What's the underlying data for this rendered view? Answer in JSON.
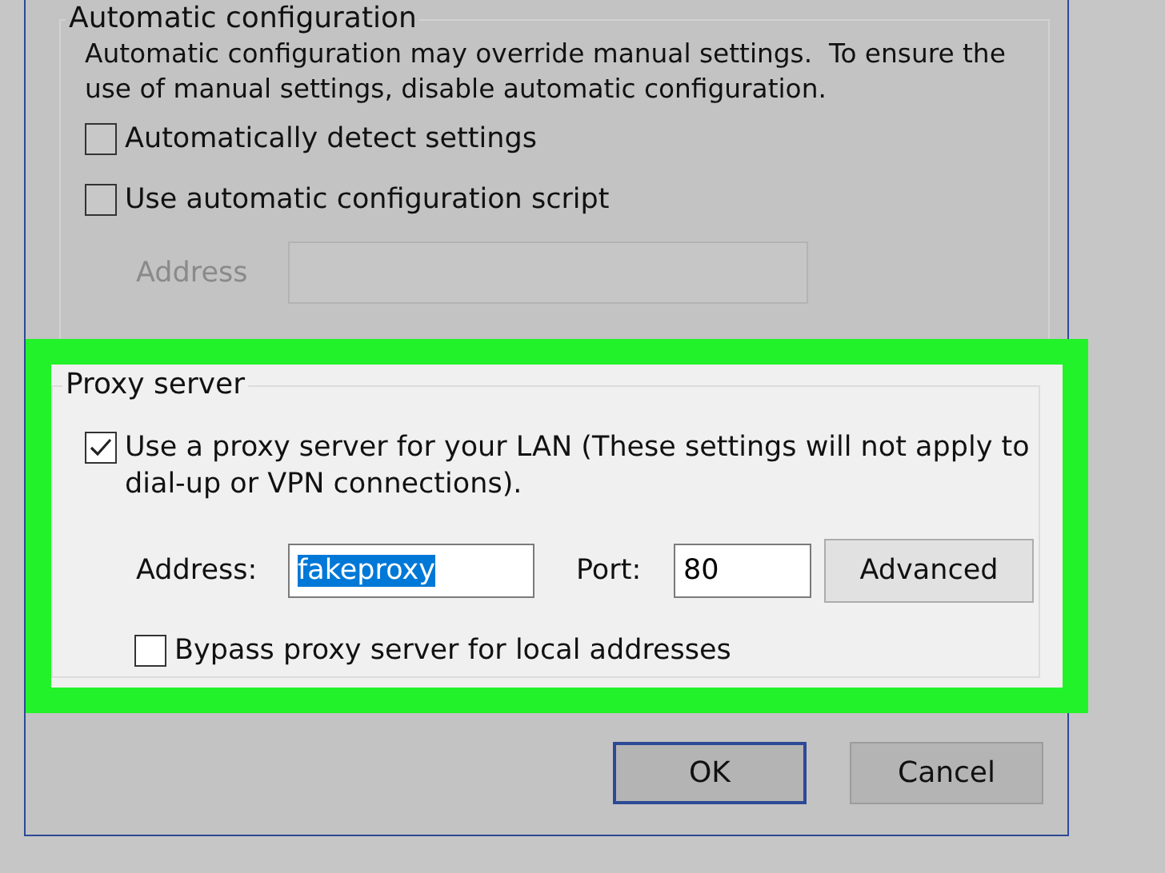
{
  "automatic_configuration": {
    "title": "Automatic configuration",
    "description": "Automatic configuration may override manual settings.  To ensure the use of manual settings, disable automatic configuration.",
    "options": [
      {
        "label": "Automatically detect settings",
        "checked": false
      },
      {
        "label": "Use automatic configuration script",
        "checked": false
      }
    ],
    "address": {
      "label": "Address",
      "disabled": true
    }
  },
  "proxy_server": {
    "title": "Proxy server",
    "highlighted": true,
    "use_proxy": {
      "label": "Use a proxy server for your LAN (These settings will not apply to dial-up or VPN connections).",
      "checked": true
    },
    "address": {
      "label": "Address:",
      "value": "fakeproxy",
      "text_selected": true
    },
    "port": {
      "label": "Port:",
      "value": "80"
    },
    "advanced_button": "Advanced",
    "bypass": {
      "label": "Bypass proxy server for local addresses",
      "checked": false
    }
  },
  "buttons": [
    {
      "label": "OK",
      "default": true
    },
    {
      "label": "Cancel",
      "default": false
    }
  ]
}
